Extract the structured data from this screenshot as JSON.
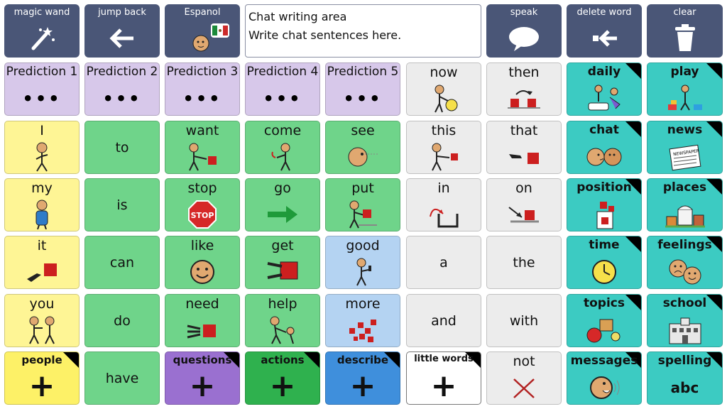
{
  "toolbar": {
    "magic_wand": "magic wand",
    "jump_back": "jump back",
    "espanol": "Espanol",
    "speak": "speak",
    "delete_word": "delete word",
    "clear": "clear"
  },
  "chat": {
    "title": "Chat writing area",
    "placeholder": "Write chat sentences here."
  },
  "predictions": {
    "p1": "Prediction 1",
    "p2": "Prediction 2",
    "p3": "Prediction 3",
    "p4": "Prediction 4",
    "p5": "Prediction 5",
    "dots": "•••"
  },
  "words": {
    "now": "now",
    "then": "then",
    "daily": "daily",
    "play": "play",
    "i": "I",
    "to": "to",
    "want": "want",
    "come": "come",
    "see": "see",
    "this": "this",
    "that": "that",
    "chat": "chat",
    "news": "news",
    "my": "my",
    "is": "is",
    "stop": "stop",
    "go": "go",
    "put": "put",
    "in": "in",
    "on": "on",
    "position": "position",
    "places": "places",
    "it": "it",
    "can": "can",
    "like": "like",
    "get": "get",
    "good": "good",
    "a": "a",
    "the": "the",
    "time": "time",
    "feelings": "feelings",
    "you": "you",
    "do": "do",
    "need": "need",
    "help": "help",
    "more": "more",
    "and": "and",
    "with": "with",
    "topics": "topics",
    "school": "school",
    "people": "people",
    "have": "have",
    "questions": "questions",
    "actions": "actions",
    "describe": "describe",
    "little_words": "little words",
    "not": "not",
    "messages": "messages",
    "spelling": "spelling"
  },
  "symbols": {
    "plus": "+",
    "abc": "abc",
    "stop_sign": "STOP",
    "newspaper": "NEWSPAPER"
  },
  "colors": {
    "toolbar": "#4a5677",
    "prediction": "#d7c8ea",
    "pronoun": "#fef595",
    "verb": "#6fd48a",
    "describe": "#b4d3f2",
    "little_word": "#ececec",
    "category": "#3ccbc2",
    "red_block": "#cc1f1f"
  }
}
